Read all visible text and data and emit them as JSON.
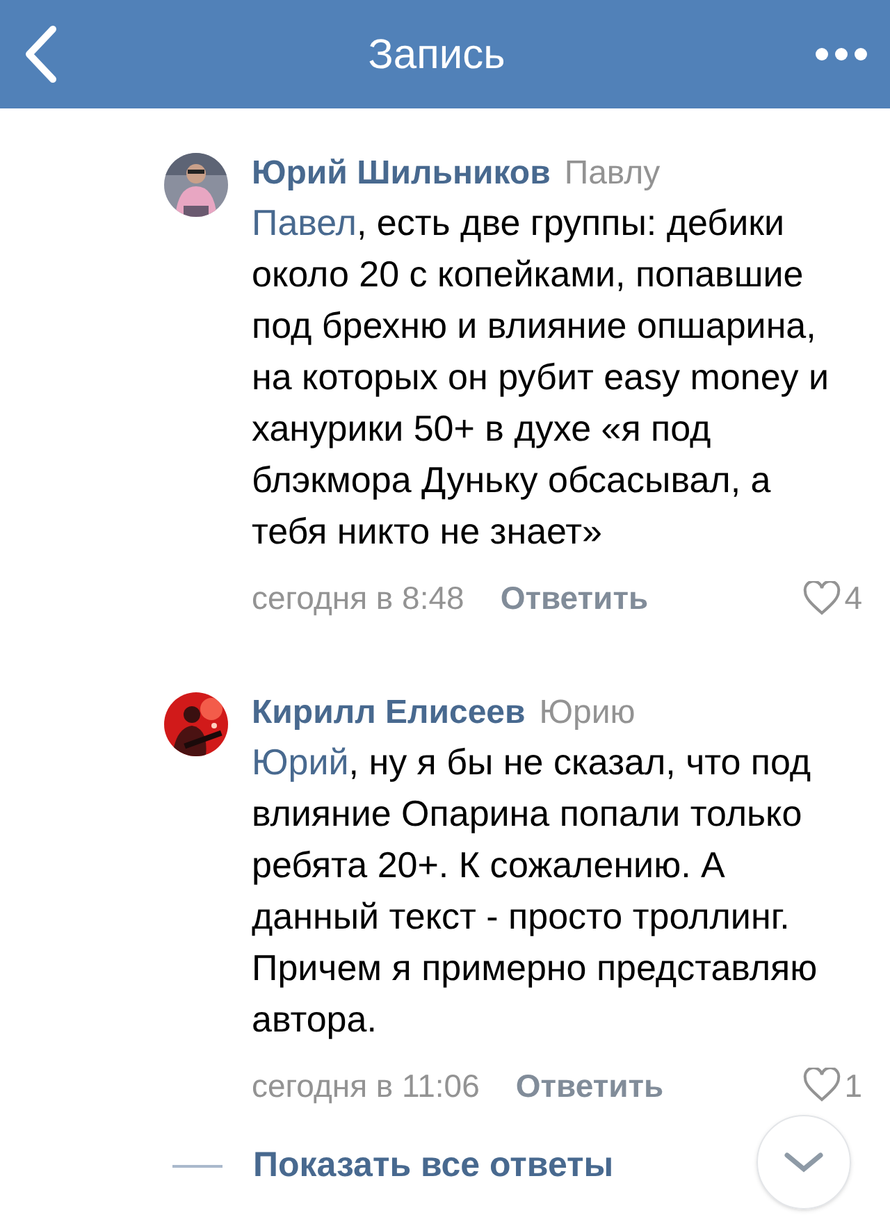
{
  "header": {
    "title": "Запись"
  },
  "comments": [
    {
      "author": "Юрий Шильников",
      "reply_to": "Павлу",
      "mention": "Павел",
      "text": ", есть две группы: дебики около 20 с копейками, попавшие под брехню и влияние опшарина, на которых он рубит easy money и ханурики 50+ в духе «я под блэкмора Дуньку обсасывал, а тебя никто не знает»",
      "time": "сегодня в 8:48",
      "reply_button": "Ответить",
      "likes": "4",
      "liked": false
    },
    {
      "author": "Кирилл Елисеев",
      "reply_to": "Юрию",
      "mention": "Юрий",
      "text": ", ну я бы не сказал, что под влияние Опарина попали только ребята 20+. К сожалению. А данный текст - просто троллинг. Причем я примерно представляю автора.",
      "time": "сегодня в 11:06",
      "reply_button": "Ответить",
      "likes": "1",
      "liked": false
    }
  ],
  "show_all_replies": "Показать все ответы"
}
